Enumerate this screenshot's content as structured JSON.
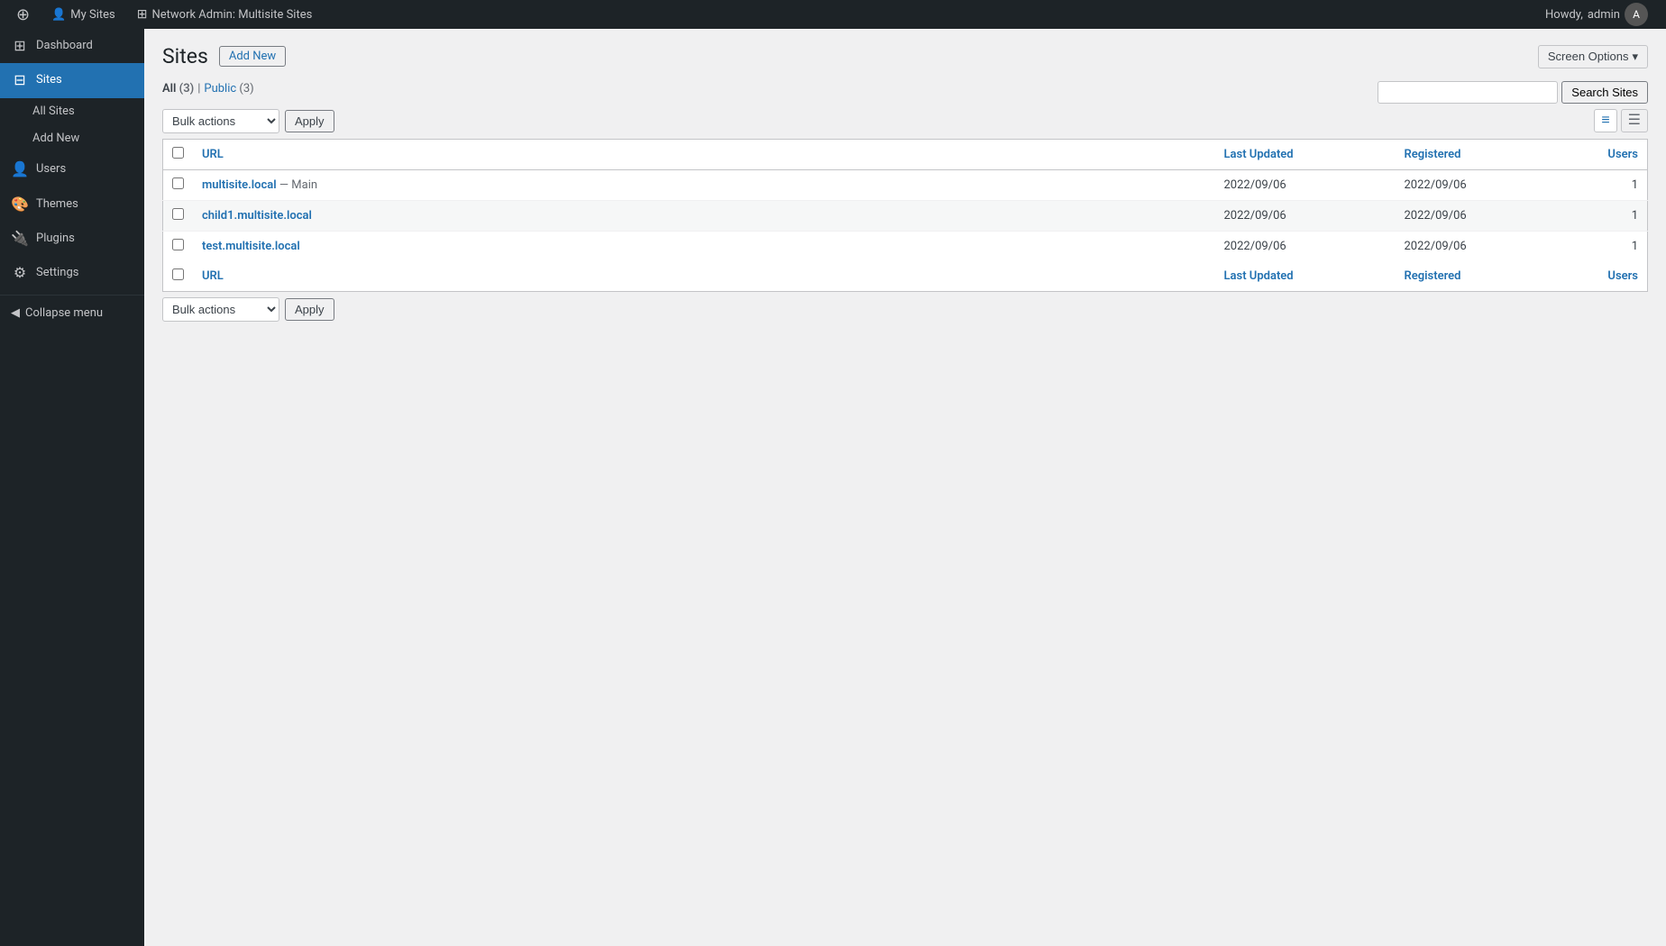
{
  "adminbar": {
    "wp_logo": "⚙",
    "my_sites_label": "My Sites",
    "network_admin_label": "Network Admin: Multisite Sites",
    "howdy_label": "Howdy,",
    "username": "admin"
  },
  "sidebar": {
    "items": [
      {
        "id": "dashboard",
        "label": "Dashboard",
        "icon": "⊞"
      },
      {
        "id": "sites",
        "label": "Sites",
        "icon": "⊟",
        "active": true
      },
      {
        "id": "all-sites",
        "label": "All Sites",
        "sub": true
      },
      {
        "id": "add-new",
        "label": "Add New",
        "sub": true
      },
      {
        "id": "users",
        "label": "Users",
        "icon": "👤"
      },
      {
        "id": "themes",
        "label": "Themes",
        "icon": "🎨"
      },
      {
        "id": "plugins",
        "label": "Plugins",
        "icon": "🔌"
      },
      {
        "id": "settings",
        "label": "Settings",
        "icon": "⚙"
      }
    ],
    "collapse_label": "Collapse menu"
  },
  "page": {
    "title": "Sites",
    "add_new_label": "Add New",
    "screen_options_label": "Screen Options"
  },
  "filters": {
    "all_label": "All",
    "all_count": "(3)",
    "sep": "|",
    "public_label": "Public",
    "public_count": "3"
  },
  "top_tablenav": {
    "bulk_actions_label": "Bulk actions",
    "apply_label": "Apply",
    "search_placeholder": "",
    "search_button_label": "Search Sites"
  },
  "bottom_tablenav": {
    "bulk_actions_label": "Bulk actions",
    "apply_label": "Apply"
  },
  "table": {
    "columns": [
      {
        "id": "url",
        "label": "URL"
      },
      {
        "id": "last_updated",
        "label": "Last Updated"
      },
      {
        "id": "registered",
        "label": "Registered"
      },
      {
        "id": "users",
        "label": "Users"
      }
    ],
    "rows": [
      {
        "id": "row-1",
        "url": "multisite.local",
        "url_suffix": "— Main",
        "last_updated": "2022/09/06",
        "registered": "2022/09/06",
        "users": "1"
      },
      {
        "id": "row-2",
        "url": "child1.multisite.local",
        "url_suffix": "",
        "last_updated": "2022/09/06",
        "registered": "2022/09/06",
        "users": "1"
      },
      {
        "id": "row-3",
        "url": "test.multisite.local",
        "url_suffix": "",
        "last_updated": "2022/09/06",
        "registered": "2022/09/06",
        "users": "1"
      }
    ]
  },
  "colors": {
    "link": "#2271b1",
    "sidebar_bg": "#1d2327",
    "sidebar_active": "#2271b1",
    "adminbar_bg": "#1d2327"
  }
}
